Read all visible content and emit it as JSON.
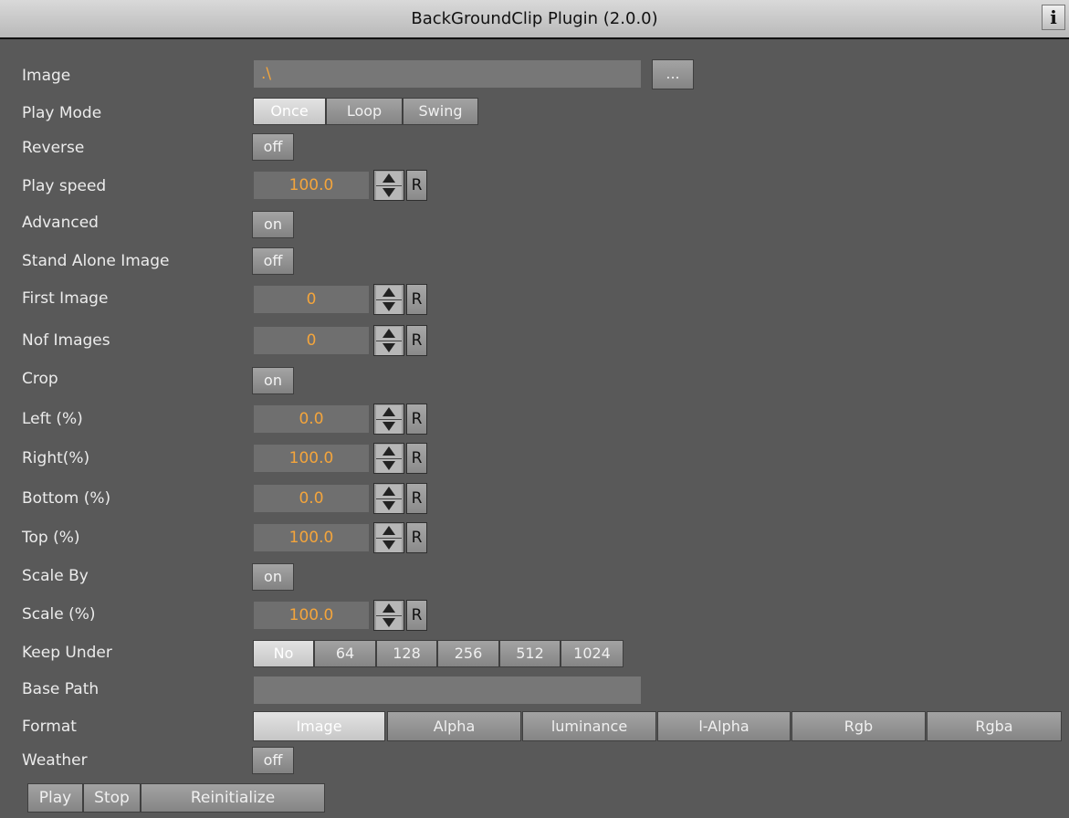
{
  "window": {
    "title": "BackGroundClip Plugin (2.0.0)",
    "info_label": "i"
  },
  "image": {
    "label": "Image",
    "value": ".\\",
    "browse_label": "..."
  },
  "play_mode": {
    "label": "Play Mode",
    "options": [
      "Once",
      "Loop",
      "Swing"
    ],
    "selected": "Once"
  },
  "reverse": {
    "label": "Reverse",
    "value": "off"
  },
  "play_speed": {
    "label": "Play speed",
    "value": "100.0",
    "reset": "R"
  },
  "advanced": {
    "label": "Advanced",
    "value": "on"
  },
  "stand_alone_image": {
    "label": "Stand Alone Image",
    "value": "off"
  },
  "first_image": {
    "label": "First Image",
    "value": "0",
    "reset": "R"
  },
  "nof_images": {
    "label": "Nof Images",
    "value": "0",
    "reset": "R"
  },
  "crop": {
    "label": "Crop",
    "value": "on"
  },
  "left": {
    "label": "Left (%)",
    "value": "0.0",
    "reset": "R"
  },
  "right": {
    "label": "Right(%)",
    "value": "100.0",
    "reset": "R"
  },
  "bottom": {
    "label": "Bottom (%)",
    "value": "0.0",
    "reset": "R"
  },
  "top": {
    "label": "Top (%)",
    "value": "100.0",
    "reset": "R"
  },
  "scale_by": {
    "label": "Scale By",
    "value": "on"
  },
  "scale": {
    "label": "Scale (%)",
    "value": "100.0",
    "reset": "R"
  },
  "keep_under": {
    "label": "Keep Under",
    "options": [
      "No",
      "64",
      "128",
      "256",
      "512",
      "1024"
    ],
    "selected": "No"
  },
  "base_path": {
    "label": "Base Path",
    "value": ""
  },
  "format": {
    "label": "Format",
    "options": [
      "Image",
      "Alpha",
      "luminance",
      "l-Alpha",
      "Rgb",
      "Rgba"
    ],
    "selected": "Image"
  },
  "weather": {
    "label": "Weather",
    "value": "off"
  },
  "actions": {
    "play": "Play",
    "stop": "Stop",
    "reinitialize": "Reinitialize"
  },
  "colors": {
    "background": "#595959",
    "value_text": "#f4a53c",
    "title_bar": "#c8c8c8"
  }
}
